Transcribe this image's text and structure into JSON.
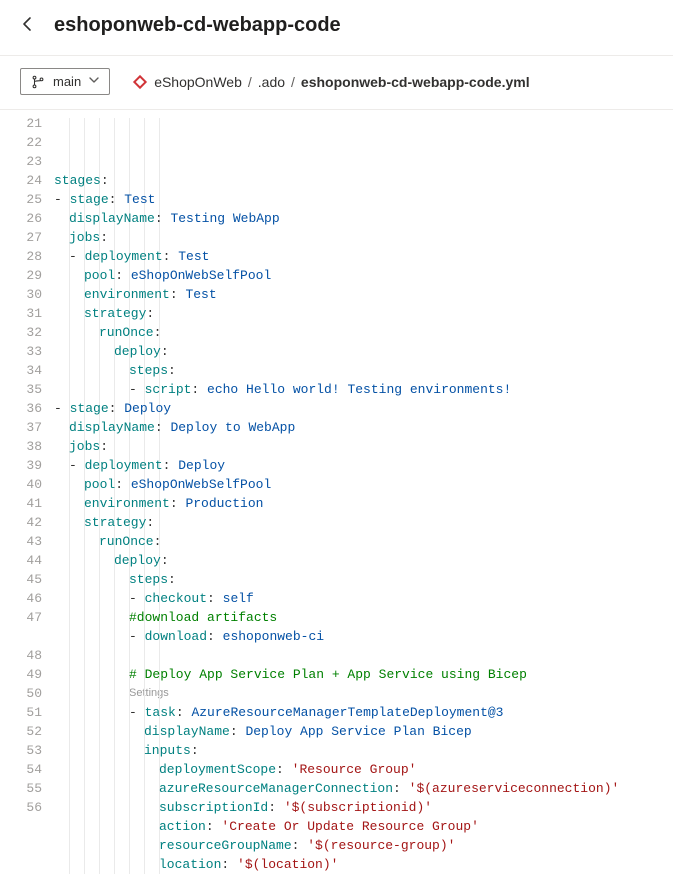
{
  "header": {
    "title": "eshoponweb-cd-webapp-code"
  },
  "branch": {
    "label": "main"
  },
  "breadcrumb": {
    "repo": "eShopOnWeb",
    "folder": ".ado",
    "file": "eshoponweb-cd-webapp-code.yml",
    "sep": "/"
  },
  "editor": {
    "startLine": 21,
    "codelens": "Settings",
    "lines": [
      {
        "n": 21,
        "i": 0,
        "t": [
          {
            "c": "key",
            "v": "stages"
          },
          {
            "c": "colon",
            "v": ":"
          }
        ]
      },
      {
        "n": 22,
        "i": 0,
        "t": [
          {
            "c": "dash",
            "v": "- "
          },
          {
            "c": "key",
            "v": "stage"
          },
          {
            "c": "colon",
            "v": ": "
          },
          {
            "c": "val",
            "v": "Test"
          }
        ]
      },
      {
        "n": 23,
        "i": 1,
        "t": [
          {
            "c": "key",
            "v": "displayName"
          },
          {
            "c": "colon",
            "v": ": "
          },
          {
            "c": "val",
            "v": "Testing WebApp"
          }
        ]
      },
      {
        "n": 24,
        "i": 1,
        "t": [
          {
            "c": "key",
            "v": "jobs"
          },
          {
            "c": "colon",
            "v": ":"
          }
        ]
      },
      {
        "n": 25,
        "i": 1,
        "t": [
          {
            "c": "dash",
            "v": "- "
          },
          {
            "c": "key",
            "v": "deployment"
          },
          {
            "c": "colon",
            "v": ": "
          },
          {
            "c": "val",
            "v": "Test"
          }
        ]
      },
      {
        "n": 26,
        "i": 2,
        "t": [
          {
            "c": "key",
            "v": "pool"
          },
          {
            "c": "colon",
            "v": ": "
          },
          {
            "c": "val",
            "v": "eShopOnWebSelfPool"
          }
        ]
      },
      {
        "n": 27,
        "i": 2,
        "t": [
          {
            "c": "key",
            "v": "environment"
          },
          {
            "c": "colon",
            "v": ": "
          },
          {
            "c": "val",
            "v": "Test"
          }
        ]
      },
      {
        "n": 28,
        "i": 2,
        "t": [
          {
            "c": "key",
            "v": "strategy"
          },
          {
            "c": "colon",
            "v": ":"
          }
        ]
      },
      {
        "n": 29,
        "i": 3,
        "t": [
          {
            "c": "key",
            "v": "runOnce"
          },
          {
            "c": "colon",
            "v": ":"
          }
        ]
      },
      {
        "n": 30,
        "i": 4,
        "t": [
          {
            "c": "key",
            "v": "deploy"
          },
          {
            "c": "colon",
            "v": ":"
          }
        ]
      },
      {
        "n": 31,
        "i": 5,
        "t": [
          {
            "c": "key",
            "v": "steps"
          },
          {
            "c": "colon",
            "v": ":"
          }
        ]
      },
      {
        "n": 32,
        "i": 5,
        "t": [
          {
            "c": "dash",
            "v": "- "
          },
          {
            "c": "key",
            "v": "script"
          },
          {
            "c": "colon",
            "v": ": "
          },
          {
            "c": "val",
            "v": "echo Hello world! Testing environments!"
          }
        ]
      },
      {
        "n": 33,
        "i": 0,
        "t": [
          {
            "c": "dash",
            "v": "- "
          },
          {
            "c": "key",
            "v": "stage"
          },
          {
            "c": "colon",
            "v": ": "
          },
          {
            "c": "val",
            "v": "Deploy"
          }
        ]
      },
      {
        "n": 34,
        "i": 1,
        "t": [
          {
            "c": "key",
            "v": "displayName"
          },
          {
            "c": "colon",
            "v": ": "
          },
          {
            "c": "val",
            "v": "Deploy to WebApp"
          }
        ]
      },
      {
        "n": 35,
        "i": 1,
        "t": [
          {
            "c": "key",
            "v": "jobs"
          },
          {
            "c": "colon",
            "v": ":"
          }
        ]
      },
      {
        "n": 36,
        "i": 1,
        "t": [
          {
            "c": "dash",
            "v": "- "
          },
          {
            "c": "key",
            "v": "deployment"
          },
          {
            "c": "colon",
            "v": ": "
          },
          {
            "c": "val",
            "v": "Deploy"
          }
        ]
      },
      {
        "n": 37,
        "i": 2,
        "t": [
          {
            "c": "key",
            "v": "pool"
          },
          {
            "c": "colon",
            "v": ": "
          },
          {
            "c": "val",
            "v": "eShopOnWebSelfPool"
          }
        ]
      },
      {
        "n": 38,
        "i": 2,
        "t": [
          {
            "c": "key",
            "v": "environment"
          },
          {
            "c": "colon",
            "v": ": "
          },
          {
            "c": "val",
            "v": "Production"
          }
        ]
      },
      {
        "n": 39,
        "i": 2,
        "t": [
          {
            "c": "key",
            "v": "strategy"
          },
          {
            "c": "colon",
            "v": ":"
          }
        ]
      },
      {
        "n": 40,
        "i": 3,
        "t": [
          {
            "c": "key",
            "v": "runOnce"
          },
          {
            "c": "colon",
            "v": ":"
          }
        ]
      },
      {
        "n": 41,
        "i": 4,
        "t": [
          {
            "c": "key",
            "v": "deploy"
          },
          {
            "c": "colon",
            "v": ":"
          }
        ]
      },
      {
        "n": 42,
        "i": 5,
        "t": [
          {
            "c": "key",
            "v": "steps"
          },
          {
            "c": "colon",
            "v": ":"
          }
        ]
      },
      {
        "n": 43,
        "i": 5,
        "t": [
          {
            "c": "dash",
            "v": "- "
          },
          {
            "c": "key",
            "v": "checkout"
          },
          {
            "c": "colon",
            "v": ": "
          },
          {
            "c": "val",
            "v": "self"
          }
        ]
      },
      {
        "n": 44,
        "i": 5,
        "t": [
          {
            "c": "comment",
            "v": "#download artifacts"
          }
        ]
      },
      {
        "n": 45,
        "i": 5,
        "t": [
          {
            "c": "dash",
            "v": "- "
          },
          {
            "c": "key",
            "v": "download"
          },
          {
            "c": "colon",
            "v": ": "
          },
          {
            "c": "val",
            "v": "eshoponweb-ci"
          }
        ]
      },
      {
        "n": 46,
        "i": 5,
        "t": []
      },
      {
        "n": 47,
        "i": 5,
        "t": [
          {
            "c": "comment",
            "v": "# Deploy App Service Plan + App Service using Bicep"
          }
        ]
      },
      {
        "codelens": true,
        "i": 5
      },
      {
        "n": 48,
        "i": 5,
        "t": [
          {
            "c": "dash",
            "v": "- "
          },
          {
            "c": "key",
            "v": "task"
          },
          {
            "c": "colon",
            "v": ": "
          },
          {
            "c": "val",
            "v": "AzureResourceManagerTemplateDeployment@3"
          }
        ]
      },
      {
        "n": 49,
        "i": 6,
        "t": [
          {
            "c": "key",
            "v": "displayName"
          },
          {
            "c": "colon",
            "v": ": "
          },
          {
            "c": "val",
            "v": "Deploy App Service Plan Bicep"
          }
        ]
      },
      {
        "n": 50,
        "i": 6,
        "t": [
          {
            "c": "key",
            "v": "inputs"
          },
          {
            "c": "colon",
            "v": ":"
          }
        ]
      },
      {
        "n": 51,
        "i": 7,
        "t": [
          {
            "c": "key",
            "v": "deploymentScope"
          },
          {
            "c": "colon",
            "v": ": "
          },
          {
            "c": "string",
            "v": "'Resource Group'"
          }
        ]
      },
      {
        "n": 52,
        "i": 7,
        "t": [
          {
            "c": "key",
            "v": "azureResourceManagerConnection"
          },
          {
            "c": "colon",
            "v": ": "
          },
          {
            "c": "string",
            "v": "'$(azureserviceconnection)'"
          }
        ]
      },
      {
        "n": 53,
        "i": 7,
        "t": [
          {
            "c": "key",
            "v": "subscriptionId"
          },
          {
            "c": "colon",
            "v": ": "
          },
          {
            "c": "string",
            "v": "'$(subscriptionid)'"
          }
        ]
      },
      {
        "n": 54,
        "i": 7,
        "t": [
          {
            "c": "key",
            "v": "action"
          },
          {
            "c": "colon",
            "v": ": "
          },
          {
            "c": "string",
            "v": "'Create Or Update Resource Group'"
          }
        ]
      },
      {
        "n": 55,
        "i": 7,
        "t": [
          {
            "c": "key",
            "v": "resourceGroupName"
          },
          {
            "c": "colon",
            "v": ": "
          },
          {
            "c": "string",
            "v": "'$(resource-group)'"
          }
        ]
      },
      {
        "n": 56,
        "i": 7,
        "t": [
          {
            "c": "key",
            "v": "location"
          },
          {
            "c": "colon",
            "v": ": "
          },
          {
            "c": "string",
            "v": "'$(location)'"
          }
        ]
      }
    ]
  }
}
